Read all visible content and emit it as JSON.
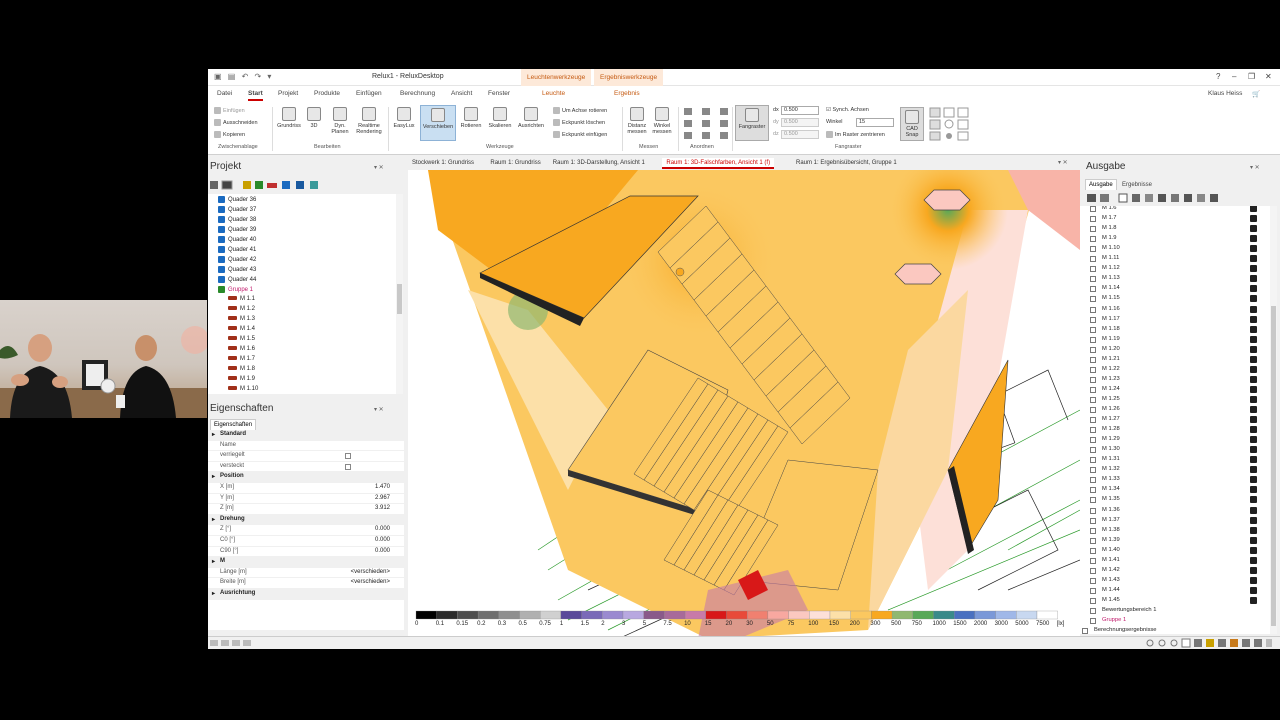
{
  "app": {
    "title": "Relux1 - ReluxDesktop",
    "context_tabs": [
      "Leuchtenwerkzeuge",
      "Ergebniswerkzeuge"
    ],
    "user": "Klaus Heiss"
  },
  "menu": {
    "tabs": [
      "Datei",
      "Start",
      "Projekt",
      "Produkte",
      "Einfügen",
      "Berechnung",
      "Ansicht",
      "Fenster"
    ],
    "active": "Start",
    "context_tabs": [
      "Leuchte",
      "Ergebnis"
    ]
  },
  "ribbon": {
    "clipboard": {
      "paste": "Einfügen",
      "cut": "Ausschneiden",
      "copy": "Kopieren",
      "label": "Zwischenablage"
    },
    "edit": {
      "floorplan": "Grundriss",
      "d3": "3D",
      "dynplan": "Dyn. Planen",
      "realtime": "Realtime Rendering",
      "label": "Bearbeiten"
    },
    "tools": {
      "easylux": "EasyLux",
      "move": "Verschieben",
      "rotate": "Rotieren",
      "scale": "Skalieren",
      "align": "Ausrichten",
      "rot_axis": "Um Achse rotieren",
      "del_corner": "Eckpunkt löschen",
      "ins_corner": "Eckpunkt einfügen",
      "label": "Werkzeuge"
    },
    "measure": {
      "dist": "Distanz messen",
      "angle": "Winkel messen",
      "label": "Messen"
    },
    "arrange": {
      "label": "Anordnen"
    },
    "grid": {
      "snap": "Fangraster",
      "dx_label": "dx",
      "dx": "0.500",
      "dy_label": "dy",
      "dy": "0.500",
      "dz_label": "dz",
      "dz": "0.500",
      "sync": "Synch. Achsen",
      "angle_label": "Winkel",
      "angle": "15",
      "center": "Im Raster zentrieren",
      "cad": "CAD Snap",
      "label": "Fangraster"
    }
  },
  "project_panel": {
    "title": "Projekt",
    "items": [
      {
        "label": "Quader 36",
        "type": "cube"
      },
      {
        "label": "Quader 37",
        "type": "cube"
      },
      {
        "label": "Quader 38",
        "type": "cube"
      },
      {
        "label": "Quader 39",
        "type": "cube"
      },
      {
        "label": "Quader 40",
        "type": "cube"
      },
      {
        "label": "Quader 41",
        "type": "cube"
      },
      {
        "label": "Quader 42",
        "type": "cube"
      },
      {
        "label": "Quader 43",
        "type": "cube"
      },
      {
        "label": "Quader 44",
        "type": "cube"
      },
      {
        "label": "Gruppe 1",
        "type": "group"
      },
      {
        "label": "M 1.1",
        "type": "lum"
      },
      {
        "label": "M 1.2",
        "type": "lum"
      },
      {
        "label": "M 1.3",
        "type": "lum"
      },
      {
        "label": "M 1.4",
        "type": "lum"
      },
      {
        "label": "M 1.5",
        "type": "lum"
      },
      {
        "label": "M 1.6",
        "type": "lum"
      },
      {
        "label": "M 1.7",
        "type": "lum"
      },
      {
        "label": "M 1.8",
        "type": "lum"
      },
      {
        "label": "M 1.9",
        "type": "lum"
      },
      {
        "label": "M 1.10",
        "type": "lum"
      }
    ]
  },
  "properties_panel": {
    "title": "Eigenschaften",
    "tab": "Eigenschaften",
    "rows": [
      {
        "kind": "section",
        "label": "Standard"
      },
      {
        "kind": "row",
        "label": "Name",
        "value": ""
      },
      {
        "kind": "check",
        "label": "verriegelt",
        "value": ""
      },
      {
        "kind": "check",
        "label": "versteckt",
        "value": ""
      },
      {
        "kind": "section",
        "label": "Position"
      },
      {
        "kind": "row",
        "label": "X [m]",
        "value": "1.470"
      },
      {
        "kind": "row",
        "label": "Y [m]",
        "value": "2.967"
      },
      {
        "kind": "row",
        "label": "Z [m]",
        "value": "3.912"
      },
      {
        "kind": "section",
        "label": "Drehung"
      },
      {
        "kind": "row",
        "label": "Z [°]",
        "value": "0.000"
      },
      {
        "kind": "row",
        "label": "C0 [°]",
        "value": "0.000"
      },
      {
        "kind": "row",
        "label": "C90 [°]",
        "value": "0.000"
      },
      {
        "kind": "section",
        "label": "M"
      },
      {
        "kind": "row",
        "label": "Länge [m]",
        "value": "<verschieden>"
      },
      {
        "kind": "row",
        "label": "Breite [m]",
        "value": "<verschieden>"
      },
      {
        "kind": "section",
        "label": "Ausrichtung"
      }
    ]
  },
  "view_tabs": {
    "items": [
      "Stockwerk 1: Grundriss",
      "Raum 1: Grundriss",
      "Raum 1: 3D-Darstellung, Ansicht 1",
      "Raum 1: 3D-Falschfarben, Ansicht 1 (f)",
      "Raum 1: Ergebnisübersicht, Gruppe 1"
    ],
    "active_index": 3
  },
  "legend": {
    "values": [
      "0",
      "0.1",
      "0.15",
      "0.2",
      "0.3",
      "0.5",
      "0.75",
      "1",
      "1.5",
      "2",
      "3",
      "5",
      "7.5",
      "10",
      "15",
      "20",
      "30",
      "50",
      "75",
      "100",
      "150",
      "200",
      "300",
      "500",
      "750",
      "1000",
      "1500",
      "2000",
      "3000",
      "5000",
      "7500",
      "[lx]"
    ],
    "colors": [
      "#000000",
      "#2b2b2b",
      "#4d4d4d",
      "#6e6e6e",
      "#8f8f8f",
      "#b0b0b0",
      "#d0d0d0",
      "#5a4a9a",
      "#7a6ab8",
      "#9a8ad0",
      "#b8a8e0",
      "#8a5a8a",
      "#a86a9a",
      "#c87aa8",
      "#d81818",
      "#e84a3a",
      "#f08070",
      "#f8a8a0",
      "#fbc8c0",
      "#fde0d8",
      "#fce0a8",
      "#fbc860",
      "#f8a820",
      "#90b870",
      "#58a858",
      "#3a8a8a",
      "#4a70c0",
      "#7a98d8",
      "#a0b8e8",
      "#c8d8f0",
      "#ffffff"
    ]
  },
  "output_panel": {
    "title": "Ausgabe",
    "tabs": [
      "Ausgabe",
      "Ergebnisse"
    ],
    "items": [
      "M 1.6",
      "M 1.7",
      "M 1.8",
      "M 1.9",
      "M 1.10",
      "M 1.11",
      "M 1.12",
      "M 1.13",
      "M 1.14",
      "M 1.15",
      "M 1.16",
      "M 1.17",
      "M 1.18",
      "M 1.19",
      "M 1.20",
      "M 1.21",
      "M 1.22",
      "M 1.23",
      "M 1.24",
      "M 1.25",
      "M 1.26",
      "M 1.27",
      "M 1.28",
      "M 1.29",
      "M 1.30",
      "M 1.31",
      "M 1.32",
      "M 1.33",
      "M 1.34",
      "M 1.35",
      "M 1.36",
      "M 1.37",
      "M 1.38",
      "M 1.39",
      "M 1.40",
      "M 1.41",
      "M 1.42",
      "M 1.43",
      "M 1.44",
      "M 1.45"
    ],
    "footer_items": [
      "Bewertungsbereich 1",
      "Gruppe 1",
      "Berechnungsergebnisse"
    ]
  },
  "colors": {
    "accent": "#c00000",
    "context": "#c55a11",
    "group": "#c0186a"
  }
}
